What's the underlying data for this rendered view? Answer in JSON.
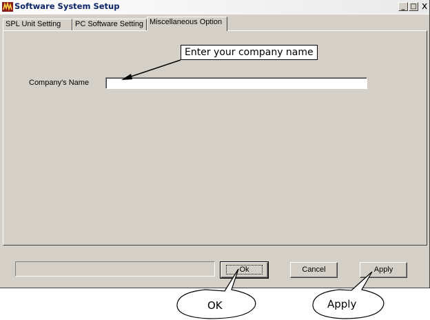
{
  "window": {
    "title": "Software System Setup",
    "icon": "app-logo-icon",
    "minimize_glyph": "_",
    "maximize_glyph": "□",
    "close_glyph": "x"
  },
  "tabs": [
    {
      "label": "SPL Unit Setting",
      "active": false
    },
    {
      "label": "PC Software Setting",
      "active": false
    },
    {
      "label": "Miscellaneous Option",
      "active": true
    }
  ],
  "form": {
    "company_label": "Company's Name",
    "company_value": ""
  },
  "buttons": {
    "ok": "Ok",
    "cancel": "Cancel",
    "apply": "Apply"
  },
  "annotations": {
    "company_callout": "Enter your company name",
    "ok_bubble": "OK",
    "apply_bubble": "Apply"
  }
}
